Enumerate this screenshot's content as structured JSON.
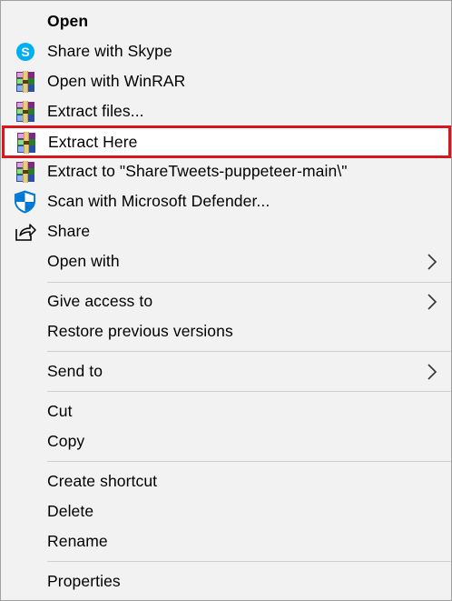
{
  "menu": {
    "items": [
      {
        "label": "Open",
        "icon": "none"
      },
      {
        "label": "Share with Skype",
        "icon": "skype-icon"
      },
      {
        "label": "Open with WinRAR",
        "icon": "winrar-icon"
      },
      {
        "label": "Extract files...",
        "icon": "winrar-icon"
      },
      {
        "label": "Extract Here",
        "icon": "winrar-icon"
      },
      {
        "label": "Extract to \"ShareTweets-puppeteer-main\\\"",
        "icon": "winrar-icon"
      },
      {
        "label": "Scan with Microsoft Defender...",
        "icon": "defender-shield-icon"
      },
      {
        "label": "Share",
        "icon": "share-icon"
      },
      {
        "label": "Open with",
        "icon": "none"
      },
      {
        "label": "Give access to",
        "icon": "none"
      },
      {
        "label": "Restore previous versions",
        "icon": "none"
      },
      {
        "label": "Send to",
        "icon": "none"
      },
      {
        "label": "Cut",
        "icon": "none"
      },
      {
        "label": "Copy",
        "icon": "none"
      },
      {
        "label": "Create shortcut",
        "icon": "none"
      },
      {
        "label": "Delete",
        "icon": "none"
      },
      {
        "label": "Rename",
        "icon": "none"
      },
      {
        "label": "Properties",
        "icon": "none"
      }
    ],
    "submenu_arrow": "chevron-right-icon"
  },
  "colors": {
    "menu_background": "#f2f2f2",
    "highlight_border": "#d9161c",
    "separator": "#cfcfcf",
    "skype_blue": "#00aff0",
    "defender_blue": "#0078d4"
  }
}
